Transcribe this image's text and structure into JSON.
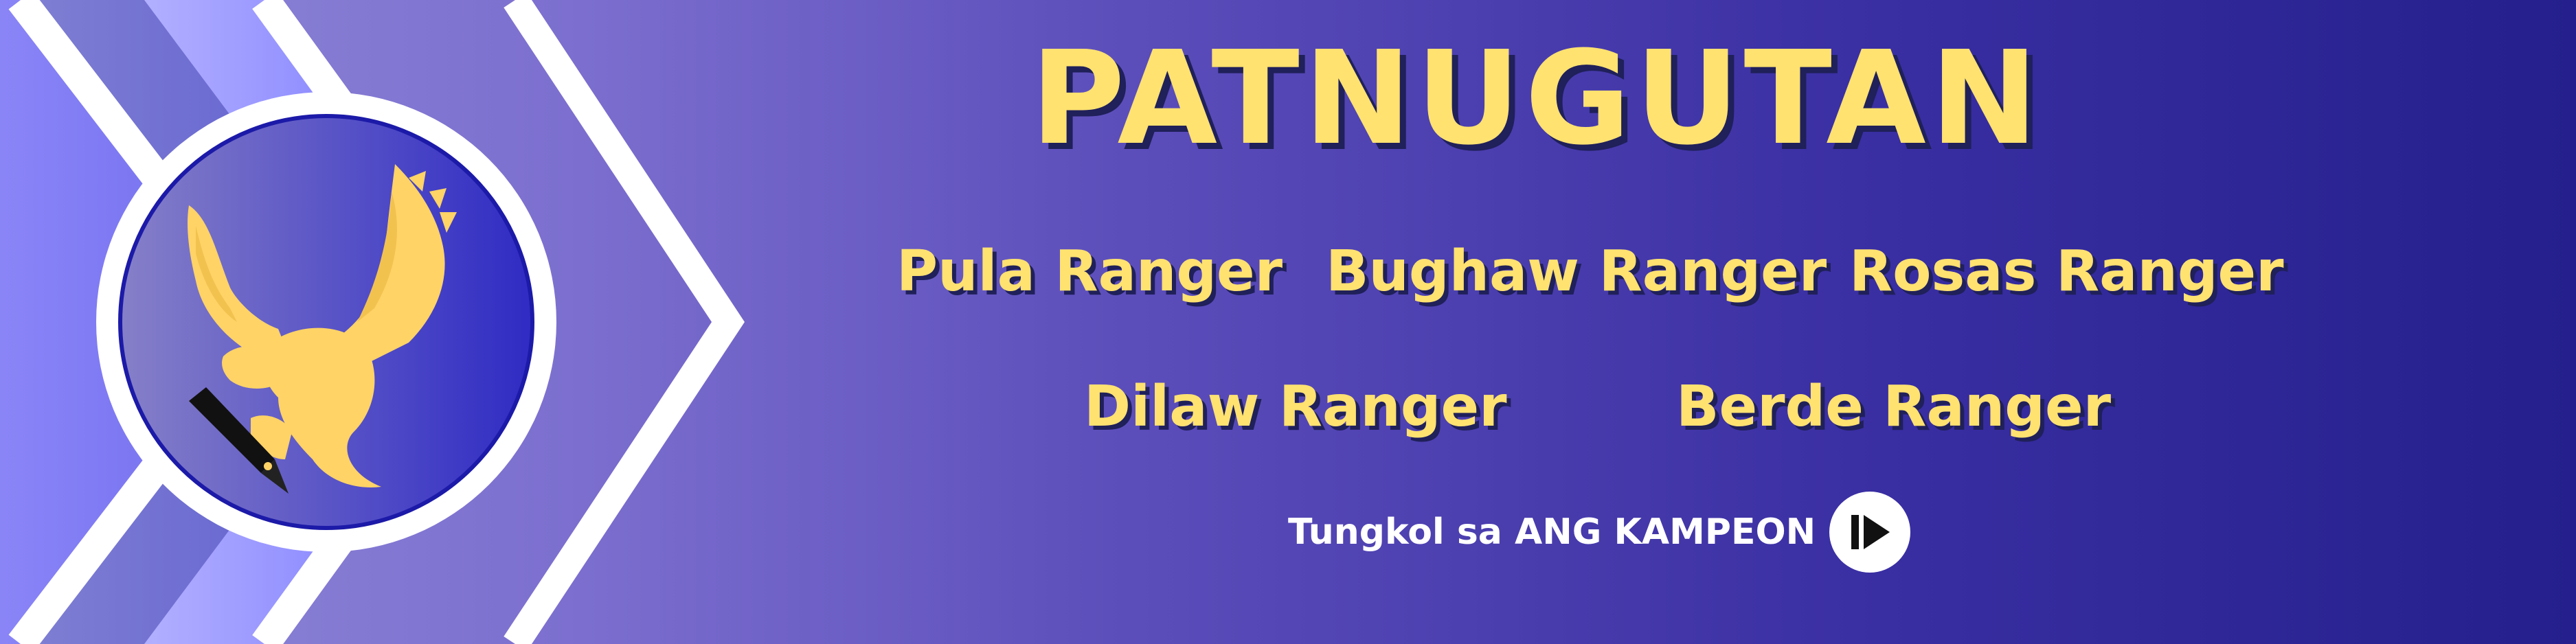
{
  "banner": {
    "title": "PATNUGUTAN",
    "rangers": [
      {
        "label": "Pula Ranger"
      },
      {
        "label": "Bughaw Ranger"
      },
      {
        "label": "Rosas Ranger"
      },
      {
        "label": "Dilaw Ranger"
      },
      {
        "label": "Berde Ranger"
      }
    ],
    "about_link": "Tungkol sa ANG KAMPEON",
    "logo_icon": "eagle-with-pen-icon",
    "play_icon": "play-next-icon"
  },
  "colors": {
    "title": "#ffe270",
    "shadow": "#20205a",
    "background_left": "#8f8ad8",
    "background_right": "#241f8c",
    "white": "#ffffff"
  }
}
